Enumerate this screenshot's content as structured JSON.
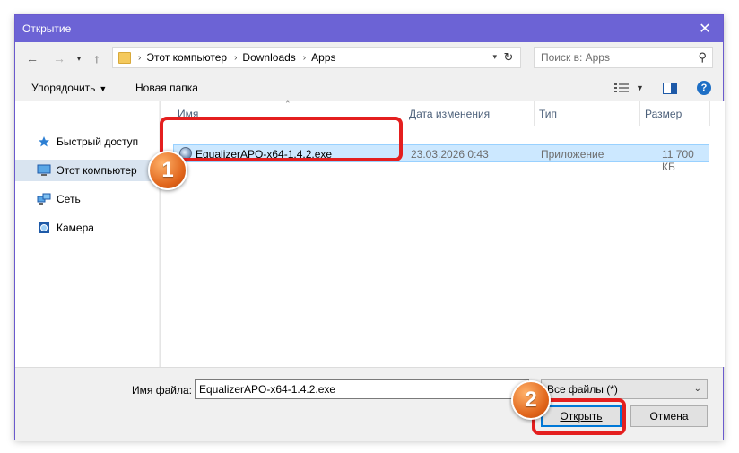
{
  "window": {
    "title": "Открытие",
    "close_glyph": "✕"
  },
  "address": {
    "breadcrumbs": [
      "Этот компьютер",
      "Downloads",
      "Apps"
    ],
    "search_placeholder": "Поиск в: Apps"
  },
  "toolbar": {
    "organize_label": "Упорядочить",
    "new_folder_label": "Новая папка"
  },
  "nav": {
    "items": [
      {
        "label": "Быстрый доступ",
        "icon": "star-icon",
        "selected": false
      },
      {
        "label": "Этот компьютер",
        "icon": "computer-icon",
        "selected": true
      },
      {
        "label": "Сеть",
        "icon": "network-icon",
        "selected": false
      },
      {
        "label": "Камера",
        "icon": "camera-icon",
        "selected": false
      }
    ]
  },
  "columns": [
    "Имя",
    "Дата изменения",
    "Тип",
    "Размер"
  ],
  "files": [
    {
      "name": "EqualizerAPO-x64-1.4.2.exe",
      "date": "23.03.2026 0:43",
      "type": "Приложение",
      "size": "11 700 КБ",
      "selected": true
    }
  ],
  "bottom": {
    "filename_label": "Имя файла:",
    "filename_value": "EqualizerAPO-x64-1.4.2.exe",
    "filetype_value": "Все файлы (*)",
    "open_label": "Открыть",
    "cancel_label": "Отмена"
  },
  "annotations": {
    "step1": "1",
    "step2": "2"
  },
  "colors": {
    "titlebar": "#6c63d5",
    "selection": "#cce8ff",
    "highlight": "#e41f1f",
    "badge": "#e0641a"
  }
}
